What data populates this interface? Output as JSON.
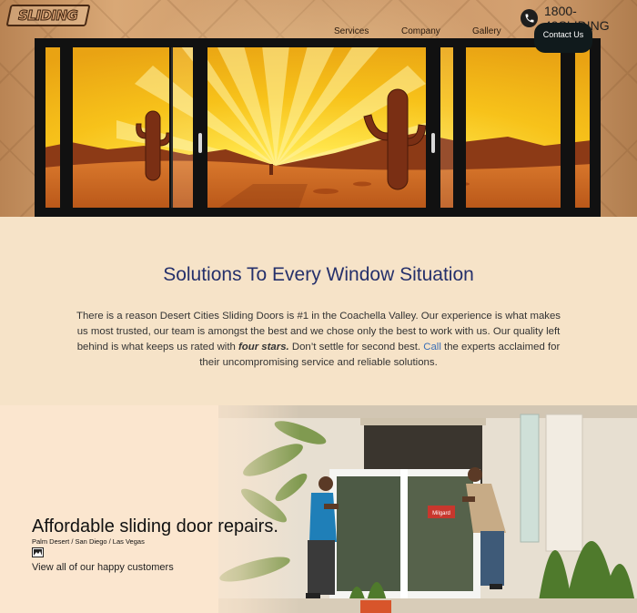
{
  "header": {
    "logo_text": "SLIDING",
    "phone": "1800-49SLIDING",
    "nav": [
      "Services",
      "Company",
      "Gallery"
    ],
    "contact_button": "Contact Us"
  },
  "intro": {
    "heading": "Solutions To Every Window Situation",
    "text_1": "There is a reason Desert Cities Sliding Doors is #1 in the Coachella Valley. Our experience is what makes us most trusted, our team is amongst the best and we chose only the best to work with us. Our quality left behind is what keeps us rated with ",
    "emphasis": "four stars.",
    "text_2": " Don’t settle for second best. ",
    "call_link": "Call",
    "text_3": " the experts acclaimed for their uncompromising service and reliable solutions."
  },
  "feature": {
    "title": "Affordable sliding door repairs.",
    "locations": "Palm Desert / San Diego / Las Vegas",
    "link": "View all of our happy customers",
    "sign_text": "Milgard"
  },
  "icons": [
    "phone-icon",
    "gallery-icon"
  ],
  "colors": {
    "heading": "#25306b",
    "link": "#3b6fb6",
    "button_bg": "#101a1c",
    "background": "#f6e3c8"
  }
}
